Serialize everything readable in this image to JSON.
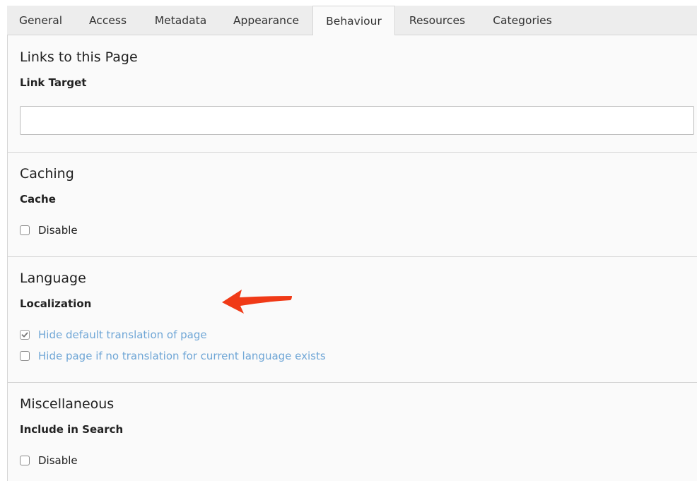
{
  "tabs": [
    {
      "label": "General"
    },
    {
      "label": "Access"
    },
    {
      "label": "Metadata"
    },
    {
      "label": "Appearance"
    },
    {
      "label": "Behaviour",
      "active": true
    },
    {
      "label": "Resources"
    },
    {
      "label": "Categories"
    }
  ],
  "sections": {
    "links": {
      "title": "Links to this Page",
      "field_label": "Link Target",
      "input_value": "",
      "input_placeholder": ""
    },
    "caching": {
      "title": "Caching",
      "field_label": "Cache",
      "options": [
        {
          "label": "Disable",
          "checked": false
        }
      ]
    },
    "language": {
      "title": "Language",
      "field_label": "Localization",
      "options": [
        {
          "label": "Hide default translation of page",
          "checked": true
        },
        {
          "label": "Hide page if no translation for current language exists",
          "checked": false
        }
      ]
    },
    "misc": {
      "title": "Miscellaneous",
      "field_label": "Include in Search",
      "options": [
        {
          "label": "Disable",
          "checked": false
        }
      ]
    }
  },
  "colors": {
    "link_text": "#6fa6d6",
    "annotation_arrow": "#f03a17",
    "tab_bar": "#ededed",
    "panel_bg": "#fafafa"
  },
  "annotation": {
    "icon": "red-arrow-icon"
  }
}
